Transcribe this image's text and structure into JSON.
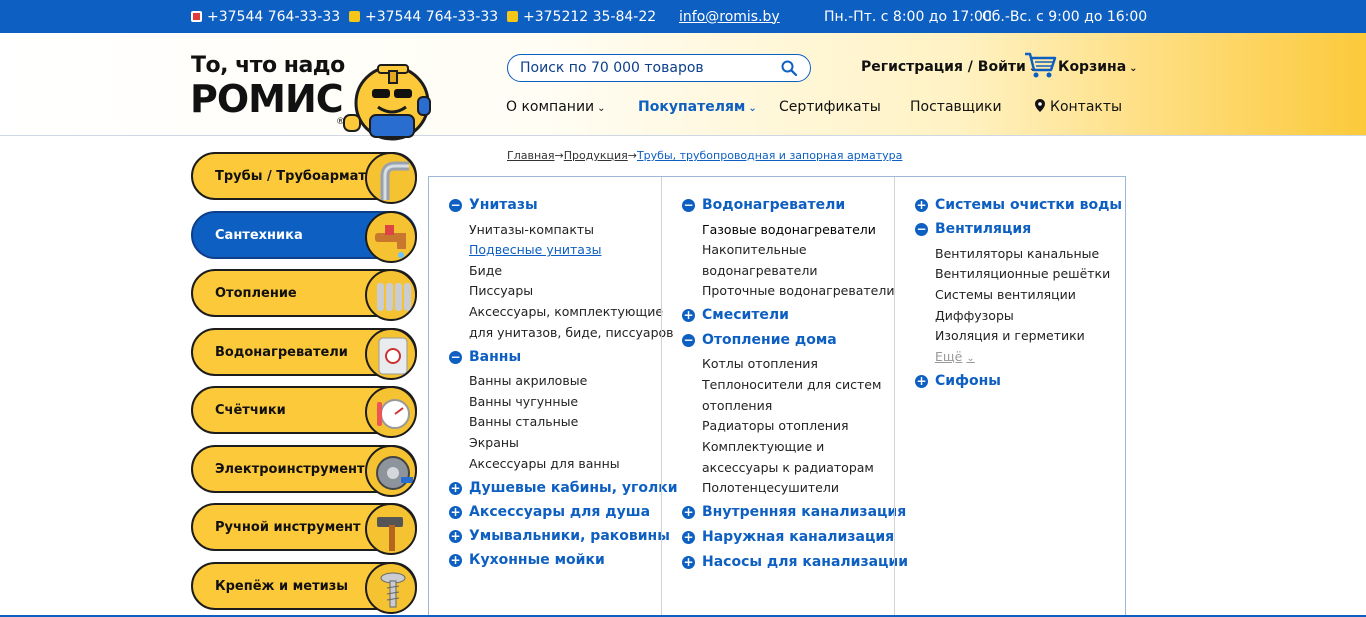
{
  "topbar": {
    "phone_a1": "+37544 764-33-33",
    "phone_viber": "+37544 764-33-33",
    "phone_city": "+375212 35-84-22",
    "email": "info@romis.by",
    "hours_weekdays": "Пн.-Пт. с 8:00 до 17:00",
    "hours_weekend": "Сб.-Вс. с 9:00 до 16:00"
  },
  "logo": {
    "line1": "То, что надо",
    "line2": "РОМИС",
    "reg": "®"
  },
  "search": {
    "placeholder": "Поиск по 70 000 товаров"
  },
  "account": {
    "label": "Регистрация / Войти",
    "cart": "Корзина"
  },
  "nav": {
    "about": "О компании",
    "buyers": "Покупателям",
    "certs": "Сертификаты",
    "suppliers": "Поставщики",
    "contacts": "Контакты"
  },
  "breadcrumb": {
    "home": "Главная",
    "products": "Продукция",
    "current": "Трубы, трубопроводная и запорная арматура",
    "sep": "→"
  },
  "categories": [
    "Трубы / Трубоарматура",
    "Сантехника",
    "Отопление",
    "Водонагреватели",
    "Счётчики",
    "Электроинструмент",
    "Ручной инструмент",
    "Крепёж и метизы"
  ],
  "menu": {
    "col1": {
      "g1": "Унитазы",
      "g1_items": [
        "Унитазы-компакты",
        "Подвесные унитазы",
        "Биде",
        "Писсуары",
        "Аксессуары, комплектующие",
        "для унитазов, биде, писсуаров"
      ],
      "g2": "Ванны",
      "g2_items": [
        "Ванны акриловые",
        "Ванны чугунные",
        "Ванны стальные",
        "Экраны",
        "Аксессуары для ванны"
      ],
      "g3": "Душевые кабины, уголки",
      "g4": "Аксессуары для душа",
      "g5": "Умывальники, раковины",
      "g6": "Кухонные мойки"
    },
    "col2": {
      "g1": "Водонагреватели",
      "g1_items": [
        "Газовые водонагреватели",
        "Накопительные",
        "водонагреватели",
        "Проточные водонагреватели"
      ],
      "g2": "Смесители",
      "g3": "Отопление дома",
      "g3_items": [
        "Котлы отопления",
        "Теплоносители для систем",
        "отопления",
        "Радиаторы отопления",
        "Комплектующие и",
        "аксессуары к радиаторам",
        "Полотенцесушители"
      ],
      "g4": "Внутренняя канализация",
      "g5": "Наружная канализация",
      "g6": "Насосы для канализации"
    },
    "col3": {
      "g1": "Системы очистки воды",
      "g2": "Вентиляция",
      "g2_items": [
        "Вентиляторы канальные",
        "Вентиляционные решётки",
        "Системы вентиляции",
        "Диффузоры",
        "Изоляция и герметики"
      ],
      "more": "Ещё",
      "g3": "Сифоны"
    }
  },
  "colors": {
    "brand_blue": "#0d5fc1",
    "brand_yellow": "#fcc93a"
  }
}
